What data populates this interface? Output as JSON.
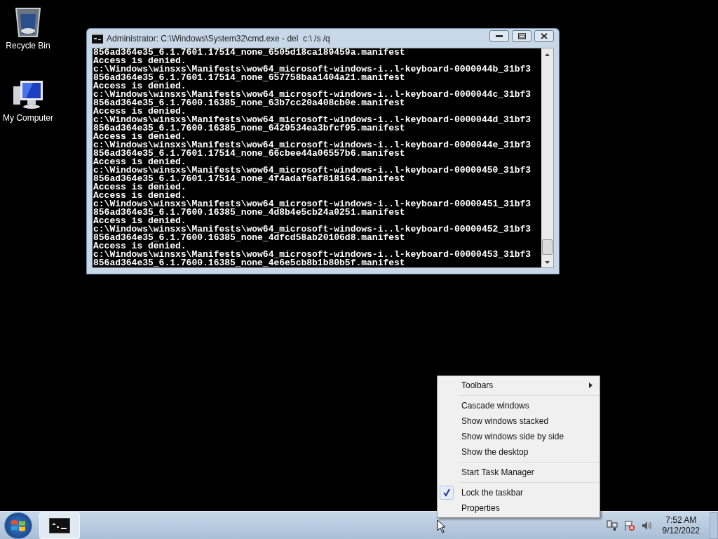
{
  "desktop_icons": [
    {
      "label": "Recycle Bin",
      "kind": "recycle"
    },
    {
      "label": "My Computer",
      "kind": "computer"
    }
  ],
  "console_window": {
    "title": "Administrator: C:\\Windows\\System32\\cmd.exe - del  c:\\ /s /q",
    "lines": [
      "856ad364e35_6.1.7601.17514_none_6505d18ca189459a.manifest",
      "Access is denied.",
      "c:\\Windows\\winsxs\\Manifests\\wow64_microsoft-windows-i..l-keyboard-0000044b_31bf3",
      "856ad364e35_6.1.7601.17514_none_657758baa1404a21.manifest",
      "Access is denied.",
      "c:\\Windows\\winsxs\\Manifests\\wow64_microsoft-windows-i..l-keyboard-0000044c_31bf3",
      "856ad364e35_6.1.7600.16385_none_63b7cc20a408cb0e.manifest",
      "Access is denied.",
      "c:\\Windows\\winsxs\\Manifests\\wow64_microsoft-windows-i..l-keyboard-0000044d_31bf3",
      "856ad364e35_6.1.7600.16385_none_6429534ea3bfcf95.manifest",
      "Access is denied.",
      "c:\\Windows\\winsxs\\Manifests\\wow64_microsoft-windows-i..l-keyboard-0000044e_31bf3",
      "856ad364e35_6.1.7601.17514_none_66cbee44a06557b6.manifest",
      "Access is denied.",
      "c:\\Windows\\winsxs\\Manifests\\wow64_microsoft-windows-i..l-keyboard-00000450_31bf3",
      "856ad364e35_6.1.7601.17514_none_4f4adaf6af818164.manifest",
      "Access is denied.",
      "Access is denied.",
      "c:\\Windows\\winsxs\\Manifests\\wow64_microsoft-windows-i..l-keyboard-00000451_31bf3",
      "856ad364e35_6.1.7600.16385_none_4d8b4e5cb24a0251.manifest",
      "Access is denied.",
      "c:\\Windows\\winsxs\\Manifests\\wow64_microsoft-windows-i..l-keyboard-00000452_31bf3",
      "856ad364e35_6.1.7600.16385_none_4dfcd58ab20106d8.manifest",
      "Access is denied.",
      "c:\\Windows\\winsxs\\Manifests\\wow64_microsoft-windows-i..l-keyboard-00000453_31bf3",
      "856ad364e35_6.1.7600.16385_none_4e6e5cb8b1b80b5f.manifest"
    ]
  },
  "context_menu": {
    "groups": [
      [
        {
          "label": "Toolbars",
          "checked": false,
          "has_submenu": true
        }
      ],
      [
        {
          "label": "Cascade windows",
          "checked": false,
          "has_submenu": false
        },
        {
          "label": "Show windows stacked",
          "checked": false,
          "has_submenu": false
        },
        {
          "label": "Show windows side by side",
          "checked": false,
          "has_submenu": false
        },
        {
          "label": "Show the desktop",
          "checked": false,
          "has_submenu": false
        }
      ],
      [
        {
          "label": "Start Task Manager",
          "checked": false,
          "has_submenu": false
        }
      ],
      [
        {
          "label": "Lock the taskbar",
          "checked": true,
          "has_submenu": false
        },
        {
          "label": "Properties",
          "checked": false,
          "has_submenu": false
        }
      ]
    ]
  },
  "taskbar": {
    "tasks": [
      {
        "kind": "console",
        "selected": true
      }
    ],
    "tray_icons": [
      {
        "kind": "network"
      },
      {
        "kind": "flag"
      },
      {
        "kind": "speaker"
      }
    ],
    "time": "7:52 AM",
    "date": "9/12/2022"
  }
}
